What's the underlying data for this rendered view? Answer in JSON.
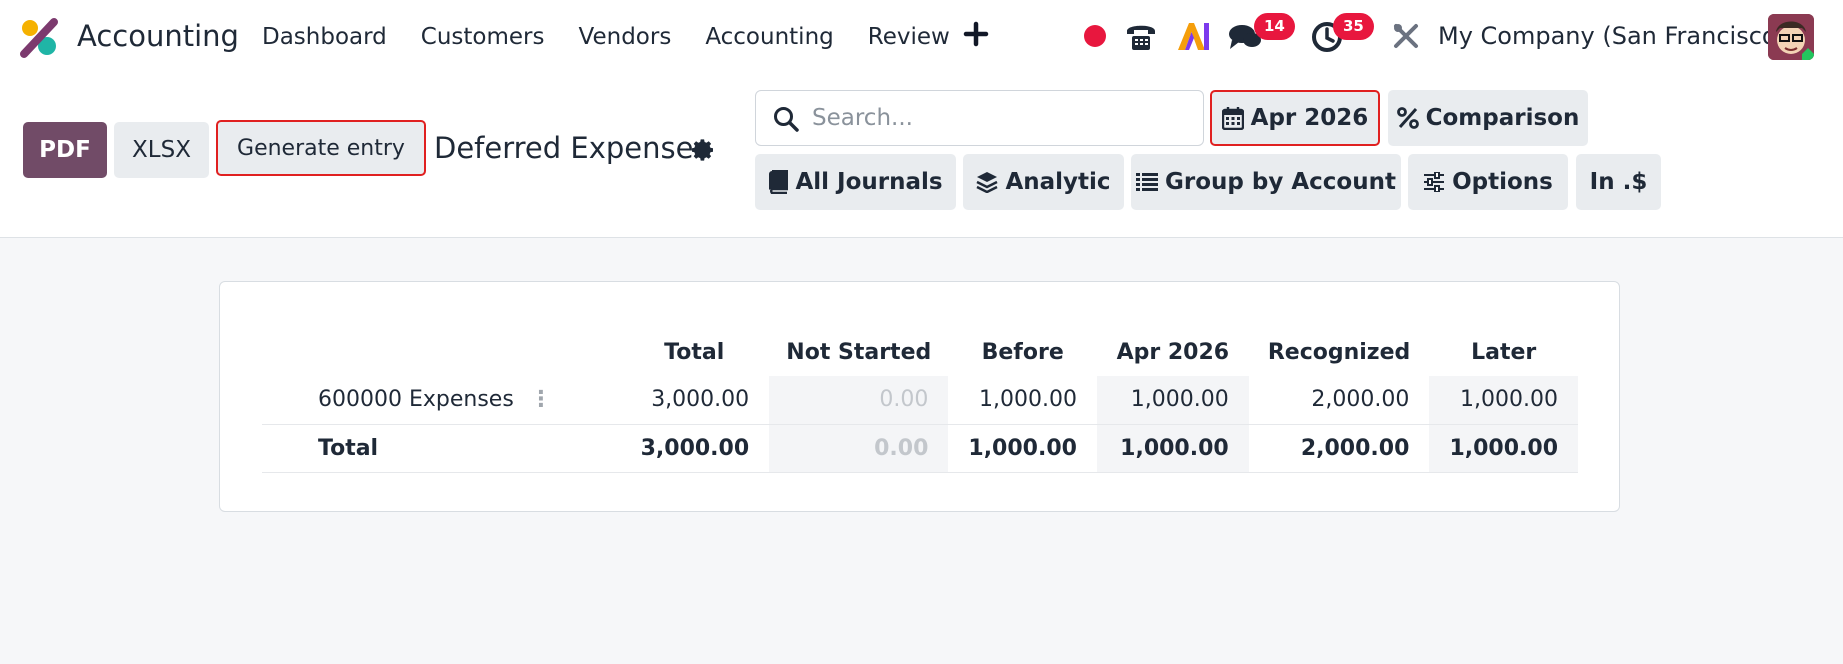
{
  "app": {
    "name": "Accounting"
  },
  "nav": {
    "items": [
      "Dashboard",
      "Customers",
      "Vendors",
      "Accounting",
      "Review"
    ]
  },
  "systray": {
    "chat_count": "14",
    "activity_count": "35",
    "company": "My Company (San Francisco)"
  },
  "toolbar": {
    "pdf_label": "PDF",
    "xlsx_label": "XLSX",
    "generate_label": "Generate entry",
    "report_title": "Deferred Expense"
  },
  "search": {
    "placeholder": "Search..."
  },
  "filters": {
    "date": "Apr 2026",
    "comparison": "Comparison",
    "journals": "All Journals",
    "analytic": "Analytic",
    "group_by": "Group by Account",
    "options": "Options",
    "currency": "In .$"
  },
  "report": {
    "columns": [
      "Total",
      "Not Started",
      "Before",
      "Apr 2026",
      "Recognized",
      "Later"
    ],
    "rows": [
      {
        "name": "600000 Expenses",
        "values": [
          "3,000.00",
          "0.00",
          "1,000.00",
          "1,000.00",
          "2,000.00",
          "1,000.00"
        ]
      }
    ],
    "total": {
      "name": "Total",
      "values": [
        "3,000.00",
        "0.00",
        "1,000.00",
        "1,000.00",
        "2,000.00",
        "1,000.00"
      ]
    }
  },
  "colors": {
    "brand": "#714b67",
    "badge": "#e8173e",
    "highlight_border": "#e02020"
  },
  "icons": [
    "app-logo-icon",
    "plus-icon",
    "record-icon",
    "phone-icon",
    "ai-icon",
    "chat-icon",
    "clock-icon",
    "tools-icon",
    "gear-icon",
    "search-icon",
    "calendar-icon",
    "percent-icon",
    "book-icon",
    "layers-icon",
    "list-icon",
    "sliders-icon",
    "kebab-icon"
  ]
}
